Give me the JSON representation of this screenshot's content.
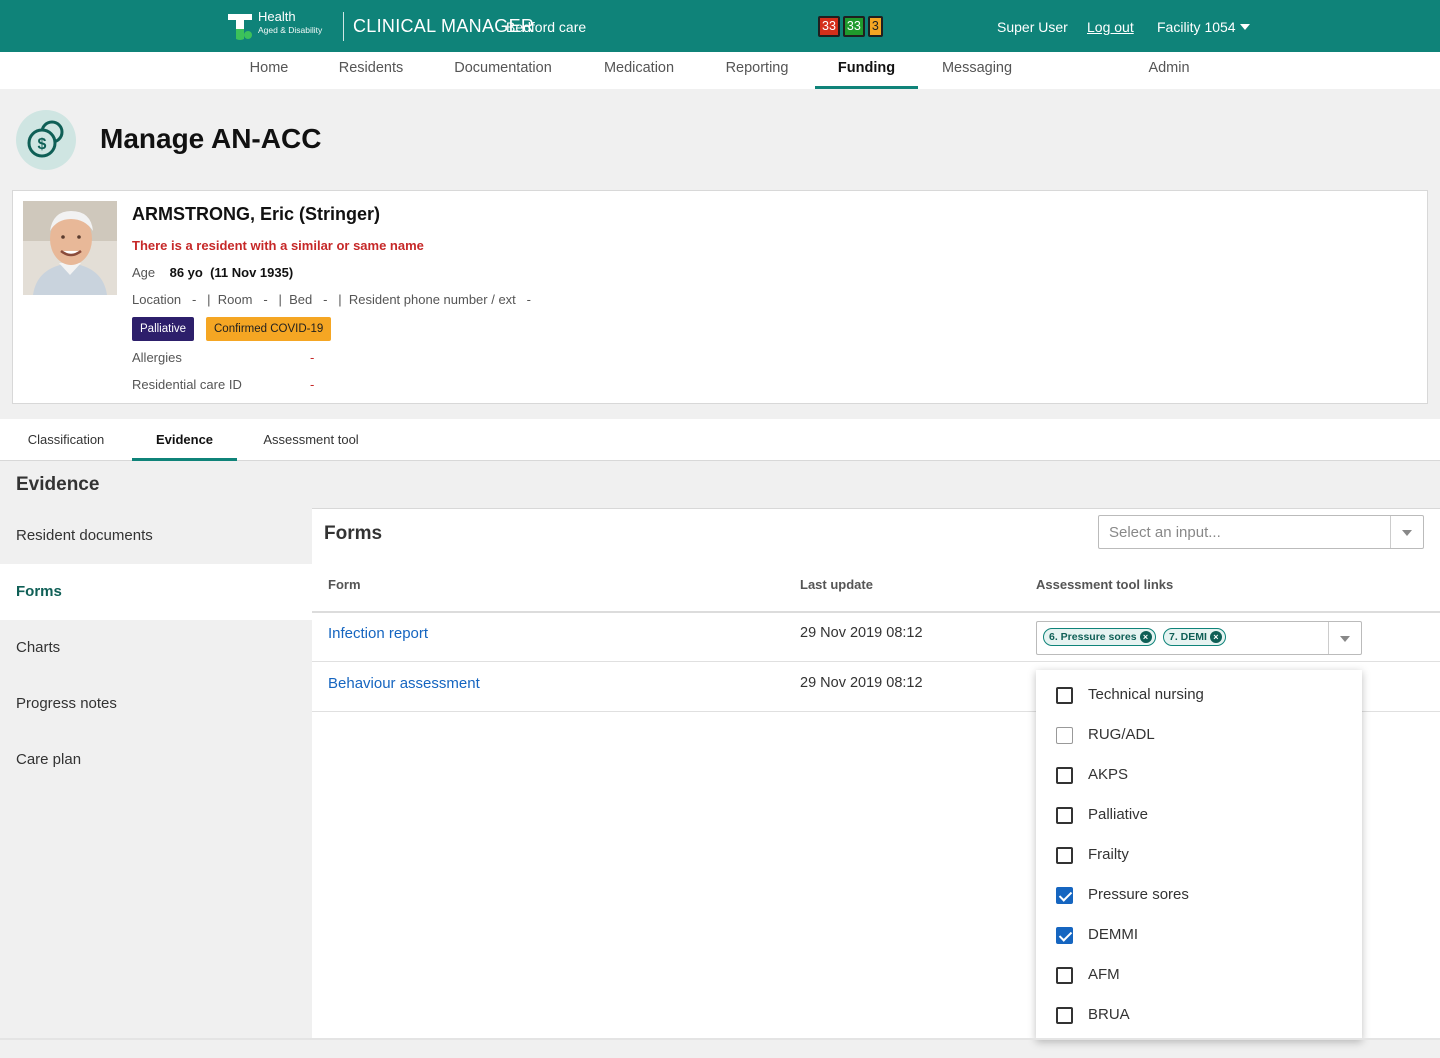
{
  "header": {
    "brand_line1": "Health",
    "brand_line2": "Aged & Disability",
    "app_name": "CLINICAL MANAGER",
    "site_name": "Bedford care",
    "counters": [
      "33",
      "33",
      "3"
    ],
    "user": "Super User",
    "logout": "Log out",
    "facility": "Facility 1054"
  },
  "nav": {
    "items": [
      "Home",
      "Residents",
      "Documentation",
      "Medication",
      "Reporting",
      "Funding",
      "Messaging",
      "Admin"
    ],
    "active": "Funding"
  },
  "page": {
    "title": "Manage AN-ACC"
  },
  "resident": {
    "name": "ARMSTRONG, Eric (Stringer)",
    "warning": "There is a resident with a similar or same name",
    "age_label": "Age",
    "age_value": "86 yo",
    "dob": "(11 Nov 1935)",
    "location_label": "Location",
    "location_value": "-",
    "room_label": "Room",
    "room_value": "-",
    "bed_label": "Bed",
    "bed_value": "-",
    "phone_label": "Resident phone number / ext",
    "phone_value": "-",
    "tags": [
      "Palliative",
      "Confirmed COVID-19"
    ],
    "allergies_label": "Allergies",
    "allergies_value": "-",
    "care_id_label": "Residential care ID",
    "care_id_value": "-"
  },
  "tabs": {
    "items": [
      "Classification",
      "Evidence",
      "Assessment tool"
    ],
    "active": "Evidence"
  },
  "evidence": {
    "title": "Evidence",
    "menu": [
      "Resident documents",
      "Forms",
      "Charts",
      "Progress notes",
      "Care plan"
    ],
    "active": "Forms"
  },
  "forms": {
    "title": "Forms",
    "select_placeholder": "Select an input...",
    "columns": [
      "Form",
      "Last update",
      "Assessment tool links"
    ],
    "rows": [
      {
        "form": "Infection report",
        "last_update": "29 Nov 2019 08:12",
        "links": [
          "6. Pressure sores",
          "7. DEMI"
        ]
      },
      {
        "form": "Behaviour assessment",
        "last_update": "29 Nov 2019 08:12",
        "links": []
      }
    ]
  },
  "dropdown": {
    "options": [
      {
        "label": "Technical nursing",
        "checked": false
      },
      {
        "label": "RUG/ADL",
        "checked": false
      },
      {
        "label": "AKPS",
        "checked": false
      },
      {
        "label": "Palliative",
        "checked": false
      },
      {
        "label": "Frailty",
        "checked": false
      },
      {
        "label": "Pressure sores",
        "checked": true
      },
      {
        "label": "DEMMI",
        "checked": true
      },
      {
        "label": "AFM",
        "checked": false
      },
      {
        "label": "BRUA",
        "checked": false
      }
    ]
  },
  "colors": {
    "brand": "#0f8379",
    "link": "#1565c0",
    "warning": "#c62828",
    "palliative": "#2d1f6b",
    "covid": "#f5a623"
  }
}
